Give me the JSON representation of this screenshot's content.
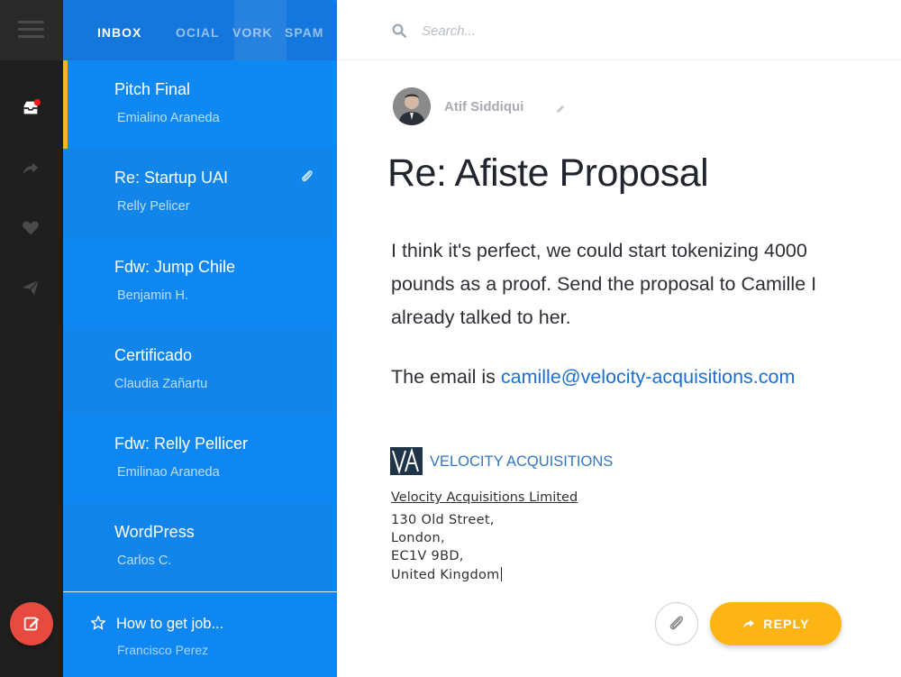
{
  "tabs": [
    {
      "label": "INBOX"
    },
    {
      "label": "OCIAL"
    },
    {
      "label": "VORK"
    },
    {
      "label": "SPAM"
    }
  ],
  "rail": {
    "icons": [
      "menu-icon",
      "inbox-icon",
      "forward-icon",
      "heart-icon",
      "send-icon",
      "compose-icon"
    ],
    "badge_color": "#ff1a1a"
  },
  "messages": [
    {
      "subject": "Pitch Final",
      "from": "Emialino Araneda"
    },
    {
      "subject": "Re: Startup UAI",
      "from": "Relly Pelicer",
      "has_attachment": true
    },
    {
      "subject": "Fdw: Jump Chile",
      "from": "Benjamin H."
    },
    {
      "subject": "Certificado",
      "from": "Claudia Zañartu"
    },
    {
      "subject": "Fdw: Relly Pellicer",
      "from": "Emilinao Araneda"
    },
    {
      "subject": "WordPress",
      "from": "Carlos C."
    }
  ],
  "bottom_message": {
    "subject": "How to get job...",
    "from": "Francisco Perez"
  },
  "search": {
    "placeholder": "Search..."
  },
  "email": {
    "sender": "Atif Siddiqui",
    "subject": "Re: Afiste Proposal",
    "body": "I think it's perfect, we could start tokenizing 4000 pounds as a proof. Send the proposal to Camille I already talked to her.",
    "email_prefix": "The email is ",
    "email_address": "camille@velocity-acquisitions.com",
    "signature": {
      "company": "VELOCITY ACQUISITIONS",
      "legal_name": "Velocity Acquisitions Limited",
      "address": [
        "130 Old Street,",
        "London,",
        "EC1V 9BD,",
        "United Kingdom"
      ]
    }
  },
  "actions": {
    "reply_label": "REPLY"
  },
  "colors": {
    "rail": "#1f1f1f",
    "list": "#0e87f2",
    "selected_marker": "#f5b52a",
    "compose": "#e94a3f",
    "reply": "#fdb515",
    "link": "#1c6fd1"
  }
}
